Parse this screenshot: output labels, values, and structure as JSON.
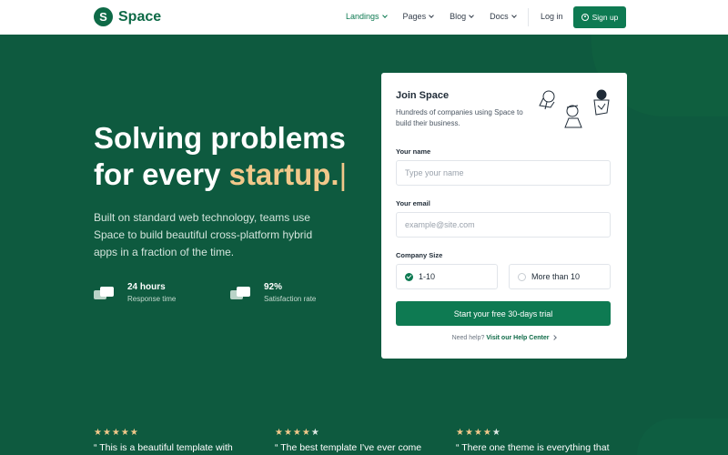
{
  "brand": {
    "logo_letter": "S",
    "name": "Space"
  },
  "nav": {
    "items": [
      {
        "label": "Landings",
        "active": true
      },
      {
        "label": "Pages",
        "active": false
      },
      {
        "label": "Blog",
        "active": false
      },
      {
        "label": "Docs",
        "active": false
      }
    ],
    "login": "Log in",
    "signup": "Sign up"
  },
  "hero": {
    "title_line1": "Solving problems",
    "title_line2_prefix": "for every ",
    "title_accent": "startup.",
    "cursor": "|",
    "description": "Built on standard web technology, teams use Space to build beautiful cross-platform hybrid apps in a fraction of the time.",
    "stats": [
      {
        "value": "24 hours",
        "label": "Response time",
        "icon": "chat-bubbles-icon"
      },
      {
        "value": "92%",
        "label": "Satisfaction rate",
        "icon": "check-bubble-icon"
      }
    ]
  },
  "form": {
    "title": "Join Space",
    "subtitle": "Hundreds of companies using Space to build their business.",
    "name_label": "Your name",
    "name_placeholder": "Type your name",
    "email_label": "Your email",
    "email_placeholder": "example@site.com",
    "size_label": "Company Size",
    "size_options": [
      {
        "label": "1-10",
        "selected": true
      },
      {
        "label": "More than 10",
        "selected": false
      }
    ],
    "cta": "Start your free 30-days trial",
    "help_text": "Need help?",
    "help_link": "Visit our Help Center"
  },
  "testimonials": [
    {
      "stars": 5,
      "quote": "“ This is a beautiful template with"
    },
    {
      "stars": 4,
      "quote": "“ The best template I've ever come"
    },
    {
      "stars": 4,
      "quote": "“ There one theme is everything that"
    }
  ],
  "colors": {
    "primary": "#0e7a52",
    "hero_bg": "#0e5a3f",
    "accent": "#f2c88a"
  }
}
